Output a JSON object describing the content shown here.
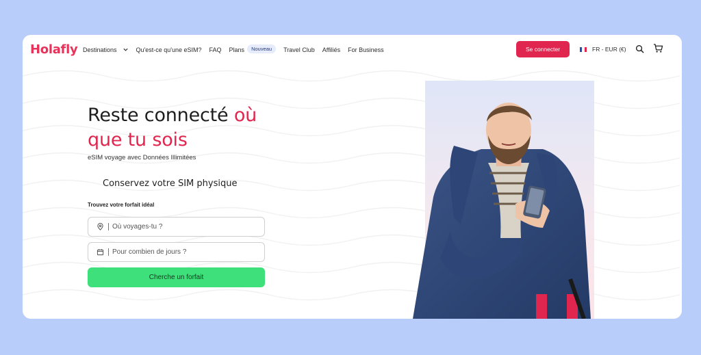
{
  "header": {
    "logo": "Holafly",
    "nav": [
      {
        "label": "Destinations"
      },
      {
        "label": "Qu'est-ce qu'une eSIM?"
      },
      {
        "label": "FAQ"
      },
      {
        "label": "Plans"
      },
      {
        "label": "Travel Club"
      },
      {
        "label": "Affiliés"
      },
      {
        "label": "For Business"
      }
    ],
    "plans_badge": "Nouveau",
    "login_label": "Se connecter",
    "locale": "FR - EUR (€)",
    "icons": {
      "dropdown": "chevron-down-icon",
      "search": "search-icon",
      "cart": "cart-icon",
      "flag": "france-flag-icon"
    }
  },
  "hero": {
    "title_line1": "Reste connecté",
    "title_accent1": "où",
    "title_accent2": "que tu sois",
    "subtitle": "eSIM voyage avec Données Illimitées",
    "feature": "Conservez votre SIM physique",
    "form_label": "Trouvez votre forfait idéal",
    "destination_placeholder": "Où voyages-tu ?",
    "days_placeholder": "Pour combien de jours ?",
    "cta_label": "Cherche un forfait",
    "icons": {
      "destination": "location-pin-icon",
      "days": "calendar-icon"
    }
  },
  "colors": {
    "page_bg": "#b9cdfb",
    "brand": "#e0264f",
    "cta": "#3ee07b",
    "badge_bg": "#e6ecfb"
  }
}
